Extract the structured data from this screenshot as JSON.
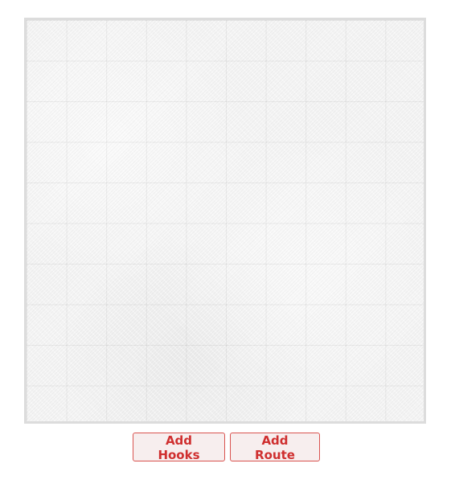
{
  "wall": {
    "colors": {
      "surface": "#f4f4f4",
      "border": "#dcdcdc",
      "grid_line": "#e6e6e6"
    }
  },
  "controls": {
    "add_hooks_label": "Add Hooks",
    "add_route_label": "Add Route",
    "colors": {
      "accent": "#d9534f",
      "text": "#cf2f2f",
      "button_bg": "#f7eeee"
    }
  }
}
